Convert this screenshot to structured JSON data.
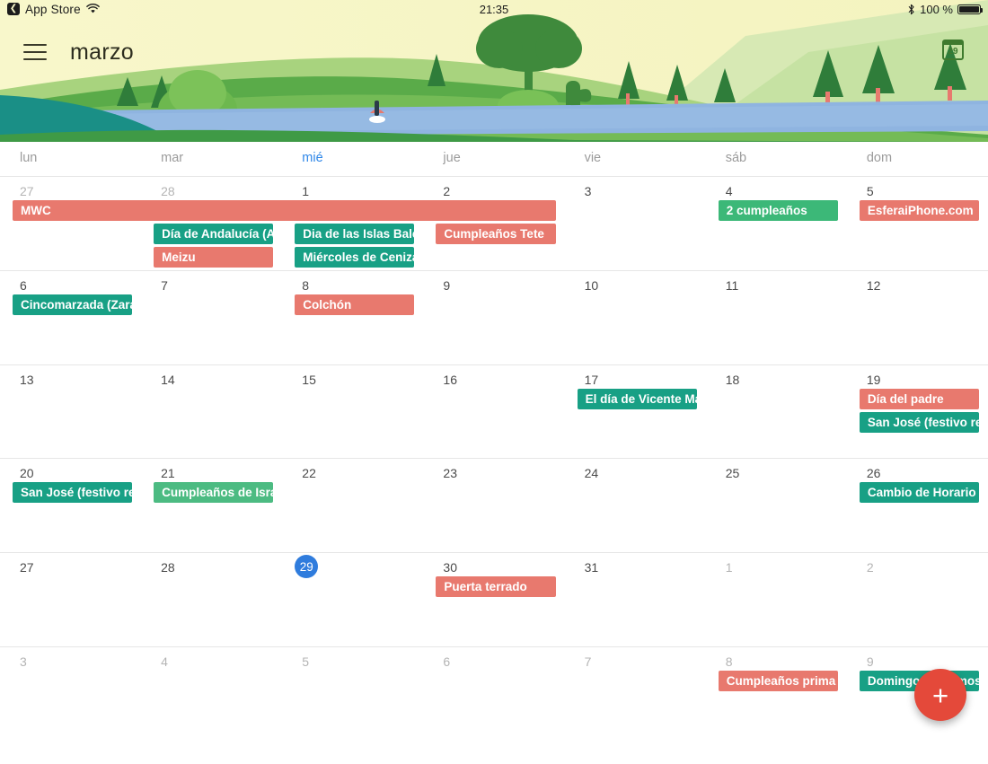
{
  "status_bar": {
    "back_app": "App Store",
    "wifi_icon": "wifi-icon",
    "time": "21:35",
    "bluetooth_icon": "bluetooth-icon",
    "battery_text": "100 %",
    "battery_icon": "battery-full-icon"
  },
  "header": {
    "menu_icon": "hamburger-menu-icon",
    "month_title": "marzo",
    "calendar_icon_label": "29",
    "sky_color": "#f7f6c9",
    "hill_color": "#7cb84b",
    "water_color": "#8fb4e0"
  },
  "weekdays": [
    {
      "label": "lun",
      "today": false
    },
    {
      "label": "mar",
      "today": false
    },
    {
      "label": "mié",
      "today": true
    },
    {
      "label": "jue",
      "today": false
    },
    {
      "label": "vie",
      "today": false
    },
    {
      "label": "sáb",
      "today": false
    },
    {
      "label": "dom",
      "today": false
    }
  ],
  "colors": {
    "event_red": "#e8796e",
    "event_teal": "#18a085",
    "event_green": "#4cbb82",
    "today_blue": "#2f7cdd",
    "fab_red": "#e4493a"
  },
  "weeks": [
    {
      "days": [
        {
          "num": "27",
          "muted": true
        },
        {
          "num": "28",
          "muted": true
        },
        {
          "num": "1",
          "muted": false
        },
        {
          "num": "2",
          "muted": false
        },
        {
          "num": "3",
          "muted": false
        },
        {
          "num": "4",
          "muted": false
        },
        {
          "num": "5",
          "muted": false
        }
      ],
      "events": [
        {
          "title": "MWC",
          "color": "#e8796e",
          "start": 0,
          "span": 4,
          "row": 0
        },
        {
          "title": "2 cumpleaños",
          "color": "#3cb878",
          "start": 5,
          "span": 1,
          "row": 0
        },
        {
          "title": "EsferaiPhone.com",
          "color": "#e8796e",
          "start": 6,
          "span": 1,
          "row": 0
        },
        {
          "title": "Día de Andalucía (An",
          "color": "#18a085",
          "start": 1,
          "span": 1,
          "row": 1
        },
        {
          "title": "Dia de las Islas Balea",
          "color": "#18a085",
          "start": 2,
          "span": 1,
          "row": 1
        },
        {
          "title": "Cumpleaños Tete",
          "color": "#e8796e",
          "start": 3,
          "span": 1,
          "row": 1
        },
        {
          "title": "Meizu",
          "color": "#e8796e",
          "start": 1,
          "span": 1,
          "row": 2
        },
        {
          "title": "Miércoles de Ceniza",
          "color": "#18a085",
          "start": 2,
          "span": 1,
          "row": 2
        }
      ]
    },
    {
      "days": [
        {
          "num": "6",
          "muted": false
        },
        {
          "num": "7",
          "muted": false
        },
        {
          "num": "8",
          "muted": false
        },
        {
          "num": "9",
          "muted": false
        },
        {
          "num": "10",
          "muted": false
        },
        {
          "num": "11",
          "muted": false
        },
        {
          "num": "12",
          "muted": false
        }
      ],
      "events": [
        {
          "title": "Cincomarzada (Zarag",
          "color": "#18a085",
          "start": 0,
          "span": 1,
          "row": 0
        },
        {
          "title": "Colchón",
          "color": "#e8796e",
          "start": 2,
          "span": 1,
          "row": 0
        }
      ]
    },
    {
      "days": [
        {
          "num": "13",
          "muted": false
        },
        {
          "num": "14",
          "muted": false
        },
        {
          "num": "15",
          "muted": false
        },
        {
          "num": "16",
          "muted": false
        },
        {
          "num": "17",
          "muted": false
        },
        {
          "num": "18",
          "muted": false
        },
        {
          "num": "19",
          "muted": false
        }
      ],
      "events": [
        {
          "title": "El día de Vicente Má",
          "color": "#18a085",
          "start": 4,
          "span": 1,
          "row": 0
        },
        {
          "title": "Día del padre",
          "color": "#e8796e",
          "start": 6,
          "span": 1,
          "row": 0
        },
        {
          "title": "San José (festivo reg",
          "color": "#18a085",
          "start": 6,
          "span": 1,
          "row": 1
        }
      ]
    },
    {
      "days": [
        {
          "num": "20",
          "muted": false
        },
        {
          "num": "21",
          "muted": false
        },
        {
          "num": "22",
          "muted": false
        },
        {
          "num": "23",
          "muted": false
        },
        {
          "num": "24",
          "muted": false
        },
        {
          "num": "25",
          "muted": false
        },
        {
          "num": "26",
          "muted": false
        }
      ],
      "events": [
        {
          "title": "San José (festivo reg",
          "color": "#18a085",
          "start": 0,
          "span": 1,
          "row": 0
        },
        {
          "title": "Cumpleaños de Israe",
          "color": "#4cbb82",
          "start": 1,
          "span": 1,
          "row": 0
        },
        {
          "title": "Cambio de Horario d",
          "color": "#18a085",
          "start": 6,
          "span": 1,
          "row": 0
        }
      ]
    },
    {
      "days": [
        {
          "num": "27",
          "muted": false
        },
        {
          "num": "28",
          "muted": false
        },
        {
          "num": "29",
          "muted": false,
          "today": true
        },
        {
          "num": "30",
          "muted": false
        },
        {
          "num": "31",
          "muted": false
        },
        {
          "num": "1",
          "muted": true
        },
        {
          "num": "2",
          "muted": true
        }
      ],
      "events": [
        {
          "title": "Puerta terrado",
          "color": "#e8796e",
          "start": 3,
          "span": 1,
          "row": 0
        }
      ]
    },
    {
      "days": [
        {
          "num": "3",
          "muted": true
        },
        {
          "num": "4",
          "muted": true
        },
        {
          "num": "5",
          "muted": true
        },
        {
          "num": "6",
          "muted": true
        },
        {
          "num": "7",
          "muted": true
        },
        {
          "num": "8",
          "muted": true
        },
        {
          "num": "9",
          "muted": true
        }
      ],
      "events": [
        {
          "title": "Cumpleaños prima A",
          "color": "#e8796e",
          "start": 5,
          "span": 1,
          "row": 0
        },
        {
          "title": "Domingo de Ramos",
          "color": "#18a085",
          "start": 6,
          "span": 1,
          "row": 0
        }
      ]
    }
  ],
  "fab": {
    "label": "+",
    "icon": "plus-icon"
  }
}
